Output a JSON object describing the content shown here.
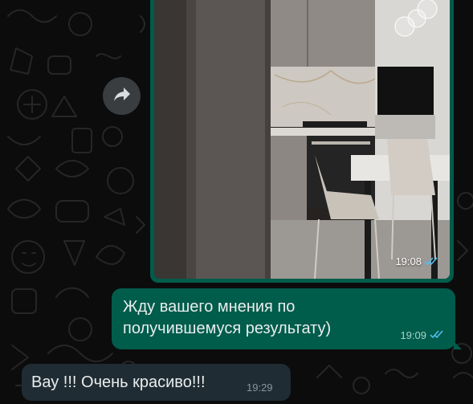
{
  "chat": {
    "photo_message": {
      "time": "19:08",
      "status_icon": "double-check-read-icon",
      "has_image": true
    },
    "outgoing_message": {
      "text": "Жду вашего мнения по получившемуся результату)",
      "time": "19:09",
      "status_icon": "double-check-read-icon"
    },
    "incoming_message": {
      "text": "Вау !!! Очень красиво!!!",
      "time": "19:29"
    },
    "forward_icon": "forward-arrow-icon"
  },
  "colors": {
    "background": "#0c0c0c",
    "outgoing_bubble": "#005c4b",
    "incoming_bubble": "#202c33",
    "read_ticks": "#53bdeb"
  }
}
